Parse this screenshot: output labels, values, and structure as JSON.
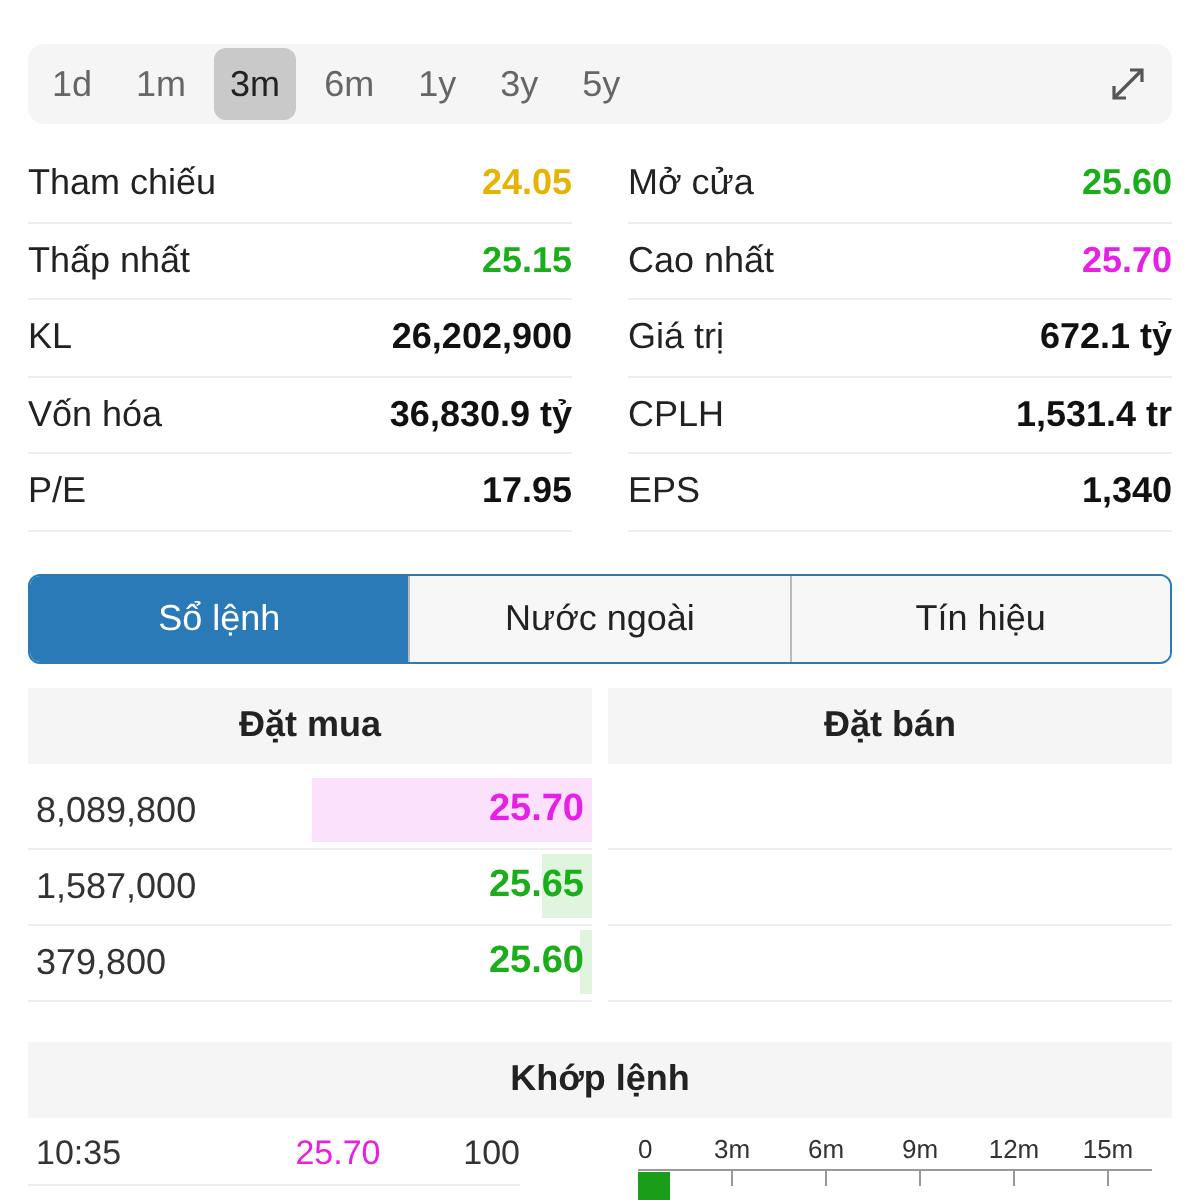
{
  "periods": [
    {
      "label": "1d",
      "selected": false
    },
    {
      "label": "1m",
      "selected": false
    },
    {
      "label": "3m",
      "selected": true
    },
    {
      "label": "6m",
      "selected": false
    },
    {
      "label": "1y",
      "selected": false
    },
    {
      "label": "3y",
      "selected": false
    },
    {
      "label": "5y",
      "selected": false
    }
  ],
  "stats": [
    {
      "label": "Tham chiếu",
      "value": "24.05",
      "color": "#e6b400"
    },
    {
      "label": "Mở cửa",
      "value": "25.60",
      "color": "#1aae1a"
    },
    {
      "label": "Thấp nhất",
      "value": "25.15",
      "color": "#1aae1a"
    },
    {
      "label": "Cao nhất",
      "value": "25.70",
      "color": "#e620e6"
    },
    {
      "label": "KL",
      "value": "26,202,900",
      "color": "#111111"
    },
    {
      "label": "Giá trị",
      "value": "672.1 tỷ",
      "color": "#111111"
    },
    {
      "label": "Vốn hóa",
      "value": "36,830.9 tỷ",
      "color": "#111111"
    },
    {
      "label": "CPLH",
      "value": "1,531.4 tr",
      "color": "#111111"
    },
    {
      "label": "P/E",
      "value": "17.95",
      "color": "#111111"
    },
    {
      "label": "EPS",
      "value": "1,340",
      "color": "#111111"
    }
  ],
  "tabs": [
    {
      "label": "Sổ lệnh",
      "selected": true
    },
    {
      "label": "Nước ngoài",
      "selected": false
    },
    {
      "label": "Tín hiệu",
      "selected": false
    }
  ],
  "order_book": {
    "buy_title": "Đặt mua",
    "sell_title": "Đặt bán",
    "buy": [
      {
        "volume": "8,089,800",
        "price": "25.70",
        "color": "#e620e6",
        "level": 0.5
      },
      {
        "volume": "1,587,000",
        "price": "25.65",
        "color": "#1aae1a",
        "level": 0.09
      },
      {
        "volume": "379,800",
        "price": "25.60",
        "color": "#1aae1a",
        "level": 0.02
      }
    ]
  },
  "matched": {
    "title": "Khớp lệnh",
    "trades": [
      {
        "time": "10:35",
        "price": "25.70",
        "volume": "100",
        "color": "#e620e6"
      }
    ],
    "volume_axis": [
      "0",
      "3m",
      "6m",
      "9m",
      "12m",
      "15m"
    ]
  }
}
